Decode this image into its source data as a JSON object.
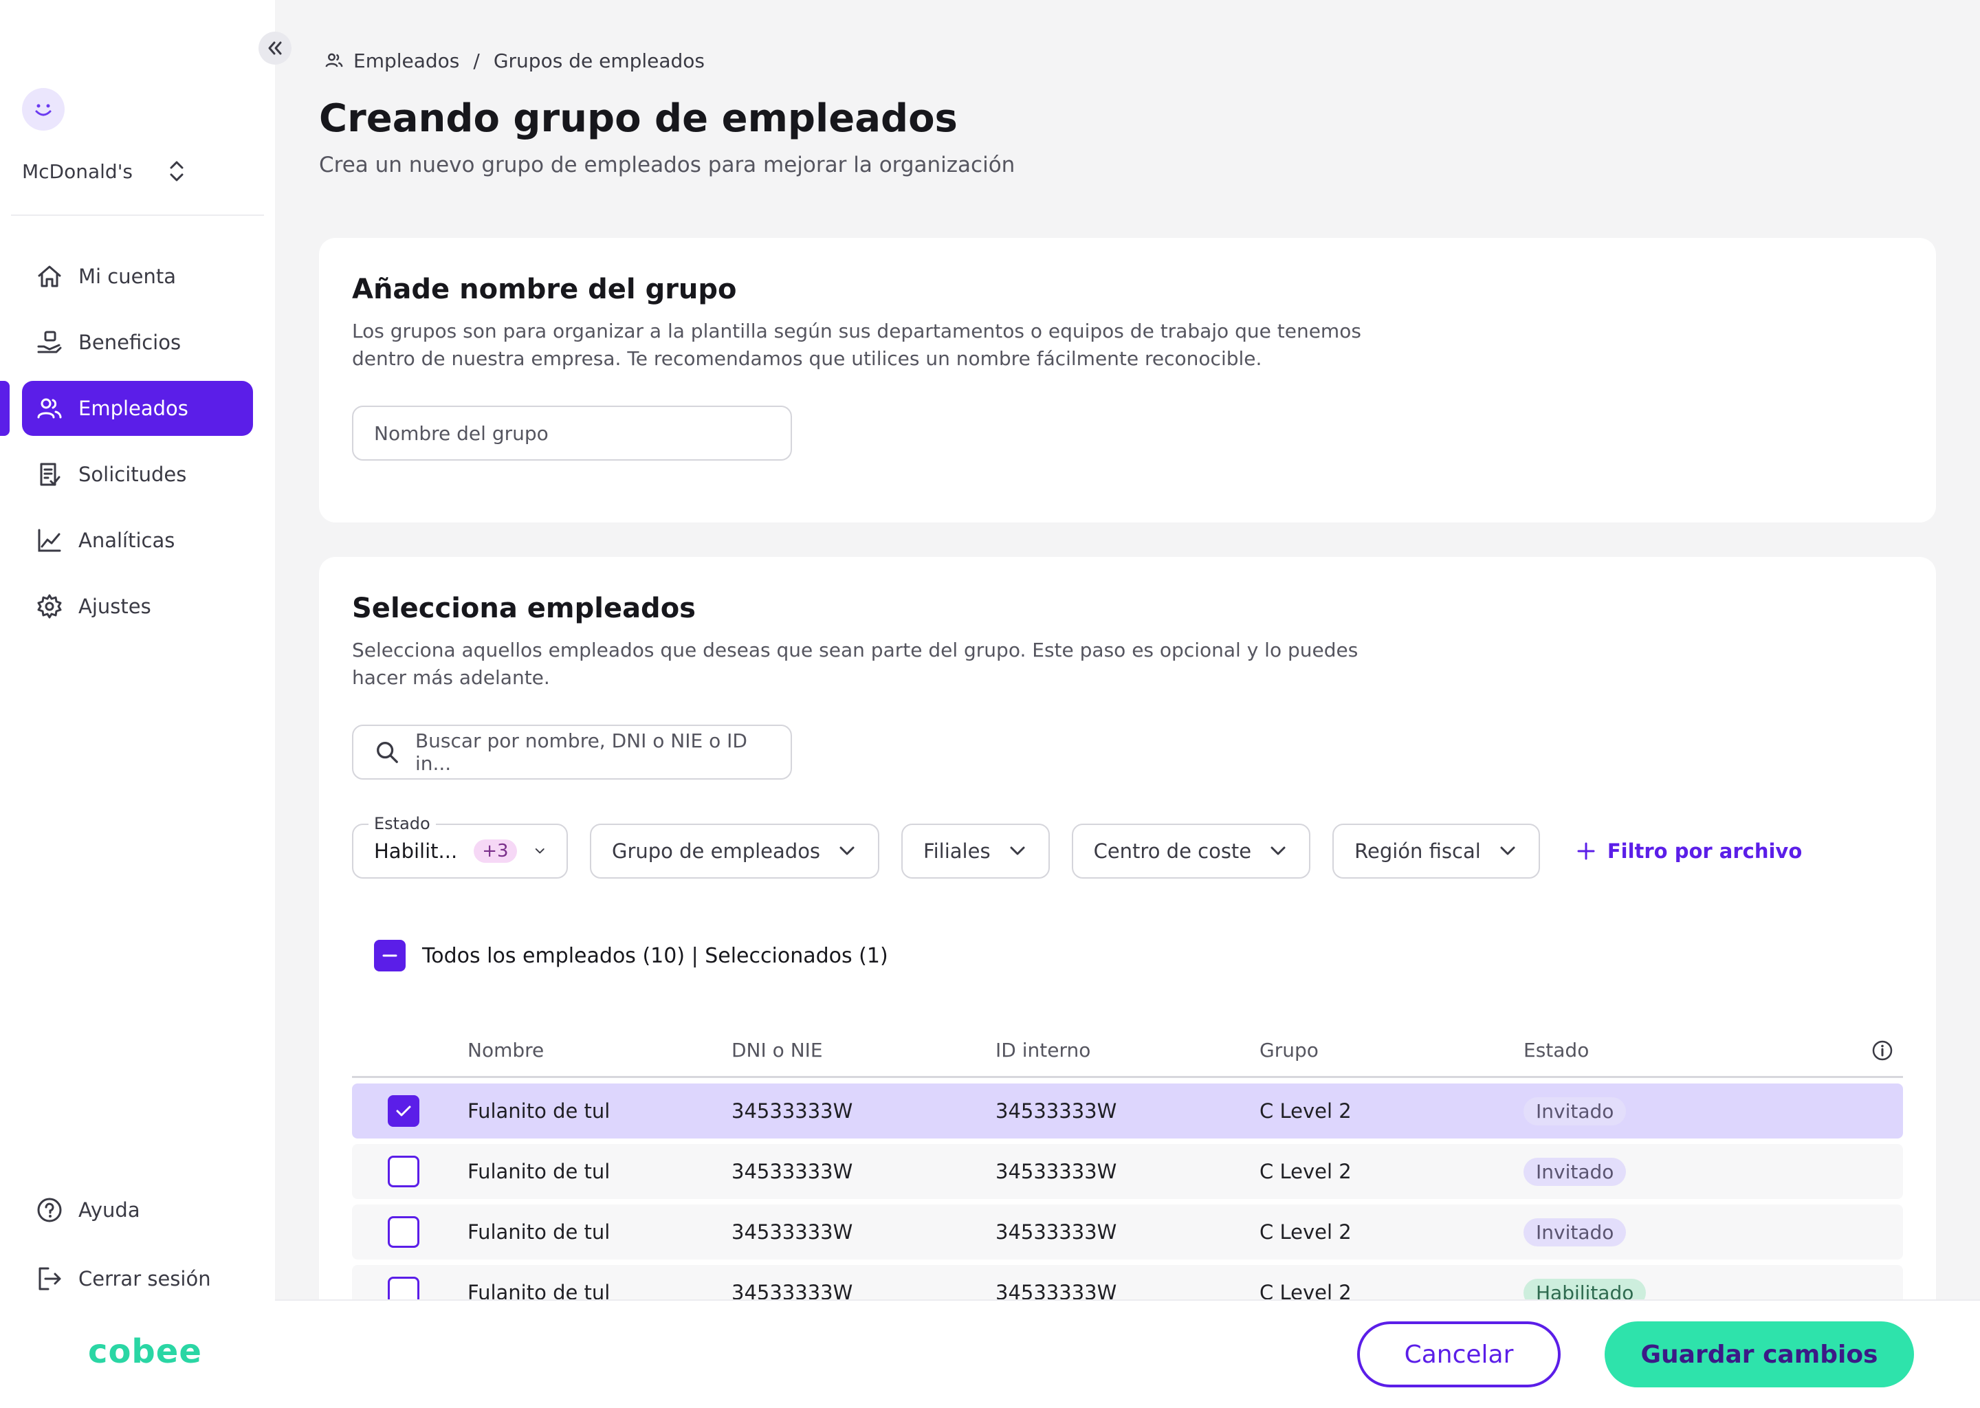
{
  "sidebar": {
    "company": "McDonald's",
    "nav": [
      {
        "label": "Mi cuenta",
        "icon": "home-icon"
      },
      {
        "label": "Beneficios",
        "icon": "benefits-icon"
      },
      {
        "label": "Empleados",
        "icon": "users-icon",
        "active": true
      },
      {
        "label": "Solicitudes",
        "icon": "document-icon"
      },
      {
        "label": "Analíticas",
        "icon": "chart-icon"
      },
      {
        "label": "Ajustes",
        "icon": "gear-icon"
      }
    ],
    "bottom": [
      {
        "label": "Ayuda",
        "icon": "help-icon"
      },
      {
        "label": "Cerrar sesión",
        "icon": "logout-icon"
      }
    ],
    "logo": "cobee"
  },
  "breadcrumb": {
    "first": "Empleados",
    "second": "Grupos de empleados"
  },
  "page": {
    "title": "Creando grupo de empleados",
    "subtitle": "Crea un nuevo grupo de empleados para mejorar la organización"
  },
  "group_name": {
    "title": "Añade nombre del grupo",
    "description": "Los grupos son para organizar a la plantilla según sus departamentos o equipos de trabajo que tenemos dentro de nuestra empresa. Te recomendamos que utilices un nombre fácilmente reconocible.",
    "placeholder": "Nombre del grupo"
  },
  "select_employees": {
    "title": "Selecciona empleados",
    "description": "Selecciona aquellos empleados que deseas que sean parte del grupo. Este paso es opcional y lo puedes hacer más adelante.",
    "search_placeholder": "Buscar por nombre, DNI o NIE o ID in..."
  },
  "filters": {
    "estado_legend": "Estado",
    "estado_value": "Habilit...",
    "estado_count": "+3",
    "grupo": "Grupo de empleados",
    "filiales": "Filiales",
    "centro": "Centro de coste",
    "region": "Región fiscal",
    "add_file": "Filtro por archivo"
  },
  "select_all": "Todos los empleados (10) | Seleccionados (1)",
  "table": {
    "headers": {
      "nombre": "Nombre",
      "dni": "DNI o NIE",
      "id": "ID interno",
      "grupo": "Grupo",
      "estado": "Estado"
    },
    "rows": [
      {
        "nombre": "Fulanito de tul",
        "dni": "34533333W",
        "id": "34533333W",
        "grupo": "C Level 2",
        "estado": "Invitado",
        "checked": true
      },
      {
        "nombre": "Fulanito de tul",
        "dni": "34533333W",
        "id": "34533333W",
        "grupo": "C Level 2",
        "estado": "Invitado",
        "checked": false
      },
      {
        "nombre": "Fulanito de tul",
        "dni": "34533333W",
        "id": "34533333W",
        "grupo": "C Level 2",
        "estado": "Invitado",
        "checked": false
      },
      {
        "nombre": "Fulanito de tul",
        "dni": "34533333W",
        "id": "34533333W",
        "grupo": "C Level 2",
        "estado": "Habilitado",
        "checked": false
      }
    ]
  },
  "footer": {
    "cancel": "Cancelar",
    "save": "Guardar cambios"
  },
  "colors": {
    "primary": "#5b1ee8",
    "accent": "#2ee3ab",
    "selected_row": "#ddd6fd"
  }
}
